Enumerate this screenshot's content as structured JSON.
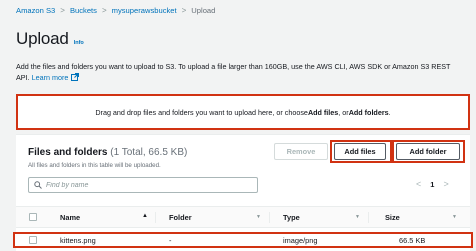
{
  "breadcrumb": {
    "items": [
      "Amazon S3",
      "Buckets",
      "mysuperawsbucket"
    ],
    "current": "Upload",
    "separator": ">"
  },
  "page": {
    "title": "Upload",
    "info_label": "Info",
    "description": "Add the files and folders you want to upload to S3. To upload a file larger than 160GB, use the AWS CLI, AWS SDK or Amazon S3 REST API.",
    "learn_more": "Learn more"
  },
  "dropzone": {
    "text_before": "Drag and drop files and folders you want to upload here, or choose ",
    "add_files": "Add files",
    "text_middle": ", or ",
    "add_folders": "Add folders",
    "text_after": "."
  },
  "files_panel": {
    "title": "Files and folders",
    "count": "(1 Total, 66.5 KB)",
    "subtitle": "All files and folders in this table will be uploaded.",
    "remove_label": "Remove",
    "add_files_label": "Add files",
    "add_folder_label": "Add folder",
    "search_placeholder": "Find by name",
    "pager": {
      "prev": "<",
      "page": "1",
      "next": ">"
    },
    "columns": {
      "name": "Name",
      "folder": "Folder",
      "type": "Type",
      "size": "Size"
    },
    "rows": [
      {
        "name": "kittens.png",
        "folder": "-",
        "type": "image/png",
        "size": "66.5 KB"
      }
    ]
  },
  "colors": {
    "link": "#0073bb",
    "highlight": "#d13212",
    "background": "#f2f3f3"
  }
}
